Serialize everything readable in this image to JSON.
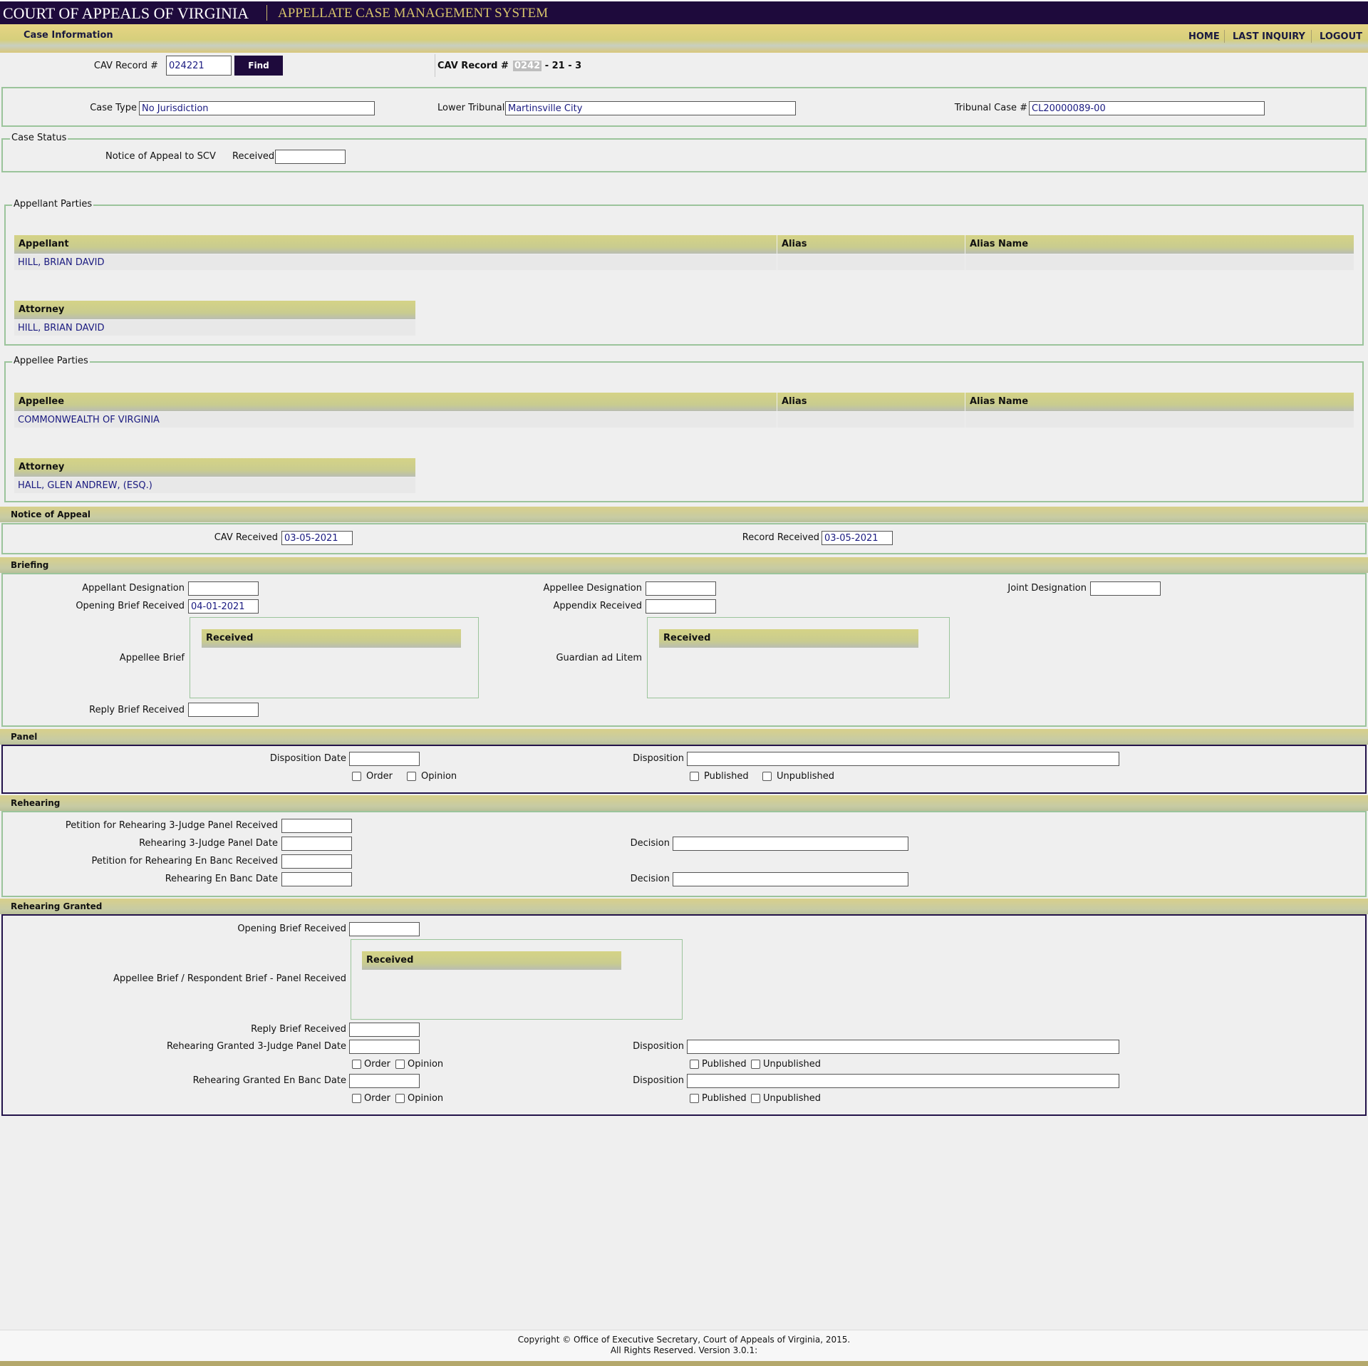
{
  "header": {
    "court": "COURT OF APPEALS OF VIRGINIA",
    "system": "APPELLATE CASE MANAGEMENT SYSTEM",
    "section_title": "Case Information",
    "nav": {
      "home": "HOME",
      "last_inquiry": "LAST INQUIRY",
      "logout": "LOGOUT"
    }
  },
  "search": {
    "label": "CAV Record #",
    "value": "024221",
    "find_label": "Find",
    "display_label": "CAV Record #",
    "display_highlight": "0242",
    "display_rest": " - 21 - 3"
  },
  "case": {
    "case_type_label": "Case Type",
    "case_type": "No Jurisdiction",
    "lower_tribunal_label": "Lower Tribunal",
    "lower_tribunal": "Martinsville City",
    "tribunal_case_label": "Tribunal Case #",
    "tribunal_case": "CL20000089-00"
  },
  "case_status": {
    "legend": "Case Status",
    "notice_label": "Notice of Appeal to SCV",
    "received_label": "Received",
    "received": ""
  },
  "appellant_parties": {
    "legend": "Appellant Parties",
    "columns": [
      "Appellant",
      "Alias",
      "Alias Name"
    ],
    "rows": [
      [
        "HILL, BRIAN DAVID",
        "",
        ""
      ]
    ],
    "attorney_header": "Attorney",
    "attorneys": [
      "HILL, BRIAN DAVID"
    ]
  },
  "appellee_parties": {
    "legend": "Appellee Parties",
    "columns": [
      "Appellee",
      "Alias",
      "Alias Name"
    ],
    "rows": [
      [
        "COMMONWEALTH OF VIRGINIA",
        "",
        ""
      ]
    ],
    "attorney_header": "Attorney",
    "attorneys": [
      "HALL, GLEN ANDREW, (ESQ.)"
    ]
  },
  "notice_of_appeal": {
    "title": "Notice of Appeal",
    "cav_received_label": "CAV Received",
    "cav_received": "03-05-2021",
    "record_received_label": "Record Received",
    "record_received": "03-05-2021"
  },
  "briefing": {
    "title": "Briefing",
    "appellant_designation_label": "Appellant Designation",
    "appellant_designation": "",
    "appellee_designation_label": "Appellee Designation",
    "appellee_designation": "",
    "joint_designation_label": "Joint Designation",
    "joint_designation": "",
    "opening_brief_label": "Opening Brief Received",
    "opening_brief": "04-01-2021",
    "appendix_label": "Appendix Received",
    "appendix": "",
    "appellee_brief_label": "Appellee Brief",
    "appellee_brief_header": "Received",
    "guardian_label": "Guardian ad Litem",
    "guardian_header": "Received",
    "reply_brief_label": "Reply Brief Received",
    "reply_brief": ""
  },
  "panel": {
    "title": "Panel",
    "disposition_date_label": "Disposition Date",
    "disposition_date": "",
    "disposition_label": "Disposition",
    "disposition": "",
    "order_label": "Order",
    "opinion_label": "Opinion",
    "published_label": "Published",
    "unpublished_label": "Unpublished"
  },
  "rehearing": {
    "title": "Rehearing",
    "petition_3judge_label": "Petition for Rehearing 3-Judge Panel Received",
    "petition_3judge": "",
    "date_3judge_label": "Rehearing 3-Judge Panel Date",
    "date_3judge": "",
    "decision1_label": "Decision",
    "decision1": "",
    "petition_enbanc_label": "Petition for Rehearing En Banc Received",
    "petition_enbanc": "",
    "date_enbanc_label": "Rehearing En Banc Date",
    "date_enbanc": "",
    "decision2_label": "Decision",
    "decision2": ""
  },
  "rehearing_granted": {
    "title": "Rehearing Granted",
    "opening_brief_label": "Opening Brief Received",
    "opening_brief": "",
    "appellee_brief_label": "Appellee Brief / Respondent Brief - Panel Received",
    "appellee_brief_header": "Received",
    "reply_brief_label": "Reply Brief Received",
    "reply_brief": "",
    "date_3judge_label": "Rehearing Granted 3-Judge Panel Date",
    "date_3judge": "",
    "disposition1_label": "Disposition",
    "disposition1": "",
    "date_enbanc_label": "Rehearing Granted En Banc Date",
    "date_enbanc": "",
    "disposition2_label": "Disposition",
    "disposition2": "",
    "order_label": "Order",
    "opinion_label": "Opinion",
    "published_label": "Published",
    "unpublished_label": "Unpublished"
  },
  "footer": {
    "line1": "Copyright © Office of Executive Secretary, Court of Appeals of Virginia, 2015.",
    "line2": "All Rights Reserved. Version 3.0.1:"
  },
  "colors": {
    "header_bg": "#1e0a3c",
    "header_gold": "#d7c46b",
    "section_bar": "#cfcd8f",
    "fieldset_border": "#9bc49b",
    "value_text": "#1a1a80"
  }
}
